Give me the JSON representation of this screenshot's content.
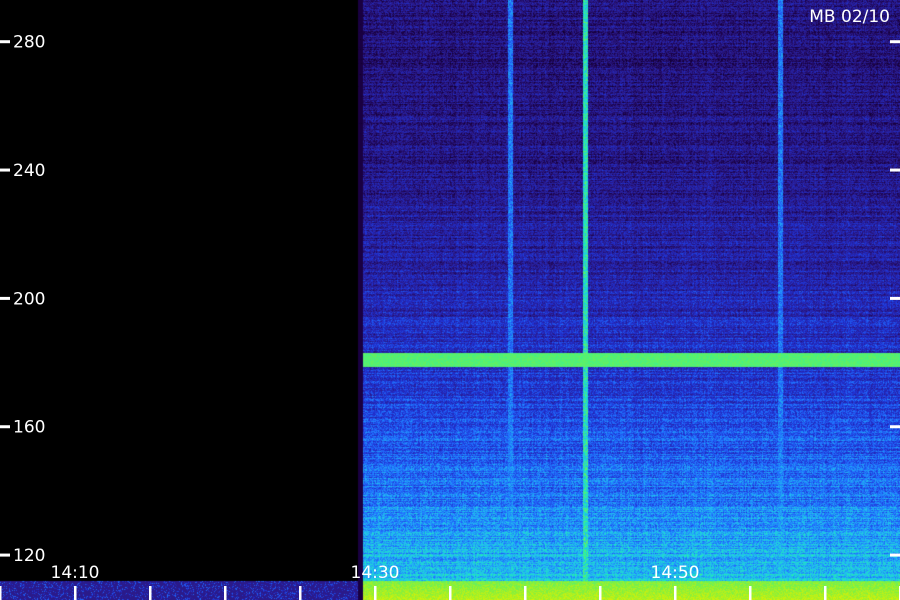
{
  "chart_data": {
    "type": "heatmap",
    "title": "MB 02/10",
    "xlabel": "",
    "ylabel": "",
    "x_ticks": [
      "14:10",
      "14:30",
      "14:50"
    ],
    "y_ticks": [
      280,
      240,
      200,
      160,
      120
    ],
    "ylim": [
      106,
      293
    ],
    "xlim": [
      "14:05",
      "15:05"
    ],
    "data_start": "14:29",
    "intensity_colormap": [
      "#000000",
      "#1a0044",
      "#2a1a8a",
      "#2030d0",
      "#2070ff",
      "#20c0f0",
      "#20f0b0",
      "#80f040",
      "#e0f000"
    ],
    "features": [
      {
        "kind": "horizontal-band",
        "y": 181,
        "intensity": 0.82
      },
      {
        "kind": "vertical-band",
        "time": "14:39",
        "intensity": 0.6
      },
      {
        "kind": "vertical-band",
        "time": "14:44",
        "intensity": 0.85
      },
      {
        "kind": "vertical-band",
        "time": "14:57",
        "intensity": 0.6
      },
      {
        "kind": "low-frequency-floor",
        "y_from": 106,
        "y_to": 112,
        "intensity": 0.95
      }
    ]
  }
}
